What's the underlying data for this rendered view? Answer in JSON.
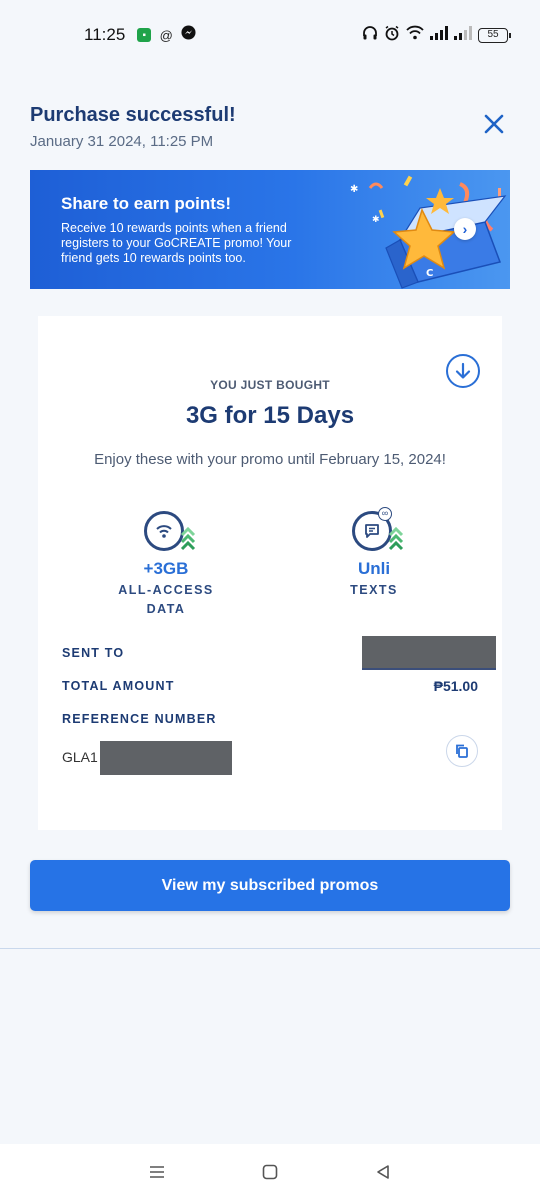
{
  "status_bar": {
    "time": "11:25",
    "battery": "55"
  },
  "header": {
    "title": "Purchase successful!",
    "subtitle": "January 31 2024, 11:25 PM"
  },
  "banner": {
    "title": "Share to earn points!",
    "text": "Receive 10 rewards points when a friend registers to your GoCREATE promo! Your friend gets 10 rewards points too."
  },
  "receipt": {
    "bought_label": "YOU JUST BOUGHT",
    "promo_name": "3G for 15 Days",
    "validity": "Enjoy these with your promo until February 15, 2024!",
    "perks": [
      {
        "value": "+3GB",
        "label_line1": "ALL-ACCESS",
        "label_line2": "DATA",
        "icon": "wifi-icon"
      },
      {
        "value": "Unli",
        "label_line1": "TEXTS",
        "label_line2": "",
        "icon": "message-icon"
      }
    ],
    "sent_to_label": "SENT TO",
    "total_amount_label": "TOTAL AMOUNT",
    "total_amount_value": "₱51.00",
    "reference_label": "REFERENCE NUMBER",
    "reference_value": "GLA1"
  },
  "primary_button": {
    "label": "View my subscribed promos"
  },
  "colors": {
    "primary": "#2673e6",
    "title": "#1d3b73",
    "background": "#f4f7fb"
  }
}
